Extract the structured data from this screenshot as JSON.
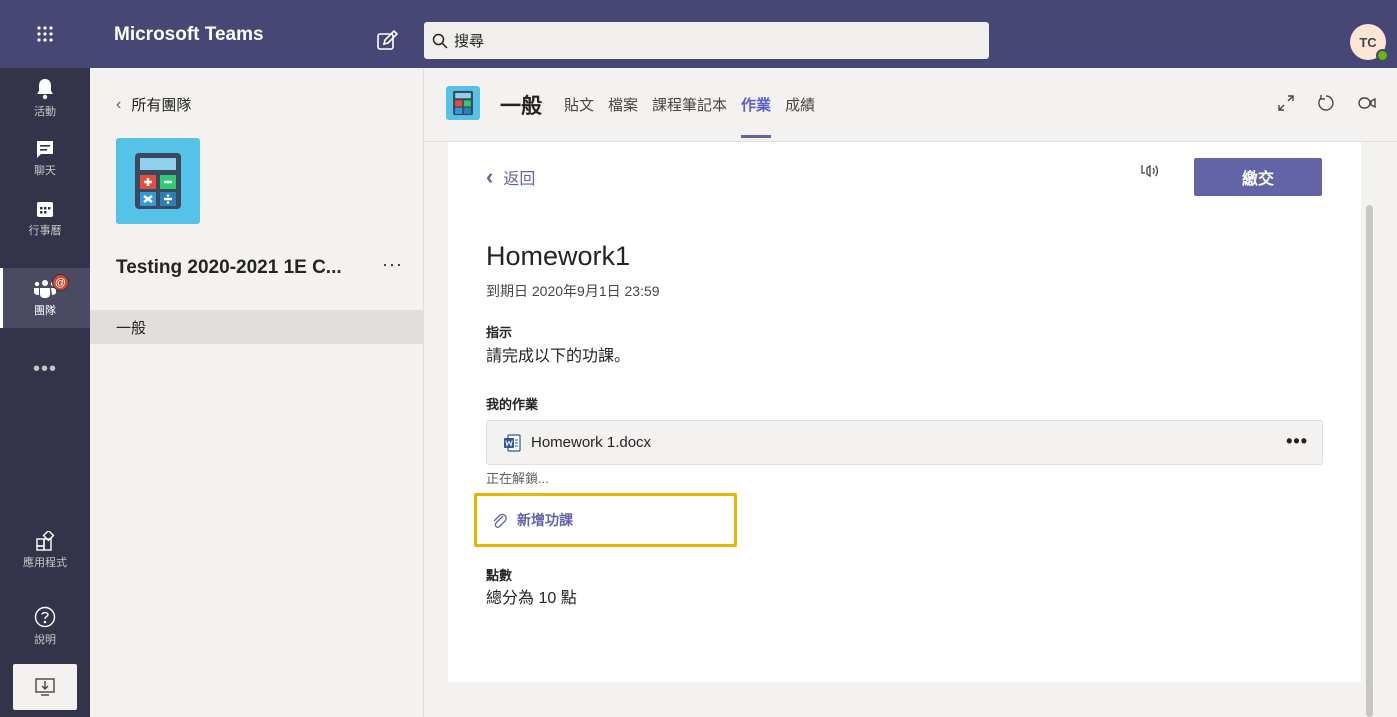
{
  "app": {
    "title": "Microsoft Teams",
    "avatar_initials": "TC"
  },
  "search": {
    "placeholder": "搜尋"
  },
  "rail": {
    "activity": "活動",
    "chat": "聊天",
    "calendar": "行事曆",
    "teams": "團隊",
    "more": "•••",
    "apps": "應用程式",
    "help": "說明",
    "mention_badge": "@"
  },
  "team_panel": {
    "back_label": "所有團隊",
    "team_name": "Testing 2020-2021 1E C...",
    "more": "···",
    "channel": "一般"
  },
  "channel_header": {
    "name": "一般",
    "tabs": [
      "貼文",
      "檔案",
      "課程筆記本",
      "作業",
      "成績"
    ],
    "active_tab": "作業"
  },
  "assignment": {
    "back_label": "返回",
    "submit_label": "繳交",
    "title": "Homework1",
    "due": "到期日 2020年9月1日 23:59",
    "instructions_label": "指示",
    "instructions": "請完成以下的功課。",
    "my_work_label": "我的作業",
    "file_name": "Homework 1.docx",
    "file_more": "•••",
    "unlock_status": "正在解鎖...",
    "add_work_label": "新增功課",
    "points_label": "點數",
    "points_text": "總分為 10 點"
  },
  "colors": {
    "brand": "#6264a7",
    "titlebar": "#464775",
    "rail": "#33344a",
    "highlight": "#e8b500"
  }
}
